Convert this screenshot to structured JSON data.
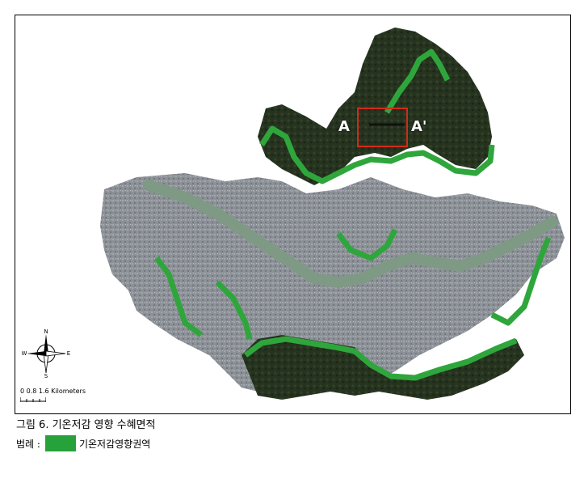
{
  "map": {
    "marker_left": "A",
    "marker_right": "A'",
    "scale_text": "0 0.8 1.6 Kilometers",
    "compass": {
      "n": "N",
      "s": "S",
      "e": "E",
      "w": "W"
    },
    "colors": {
      "forest": "#24301f",
      "urban": "#8f949a",
      "river": "#7f9a84",
      "cooling_zone": "#2fa63c",
      "inset_box": "#d22a1a"
    }
  },
  "caption": "그림 6. 기온저감 영향 수혜면적",
  "legend": {
    "label": "범례 :",
    "item": "기온저감영향권역",
    "color": "#27a23a"
  }
}
